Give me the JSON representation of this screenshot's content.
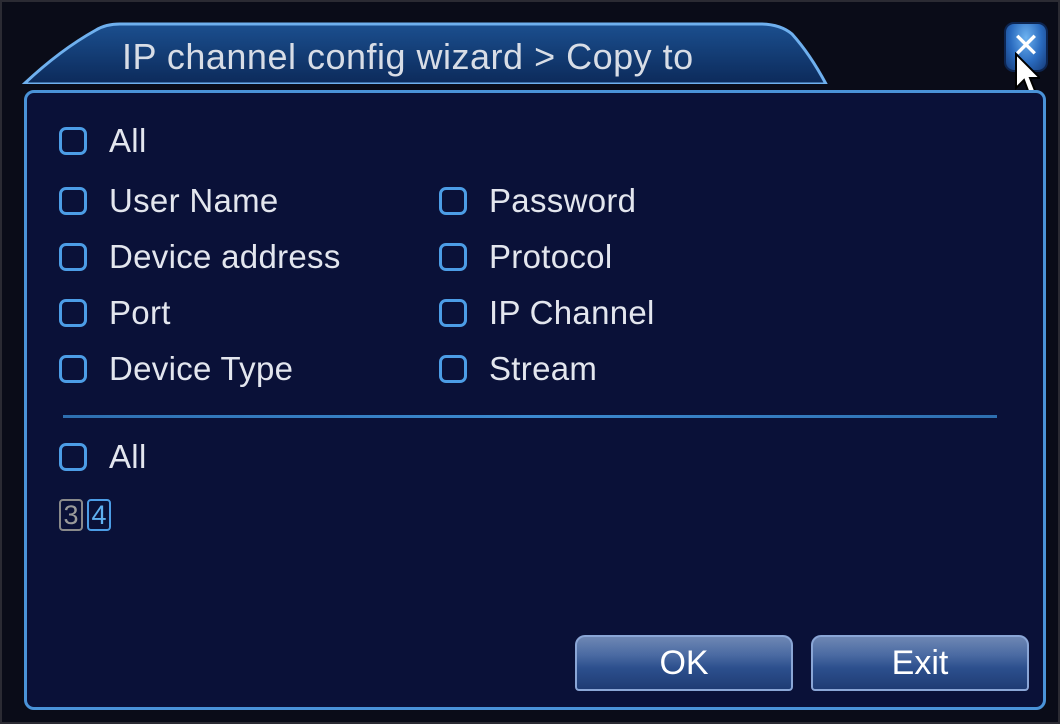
{
  "window": {
    "title": "IP channel config wizard > Copy to",
    "close_symbol": "✕"
  },
  "options_top": {
    "all_label": "All",
    "items": [
      {
        "label": "User Name"
      },
      {
        "label": "Password"
      },
      {
        "label": "Device address"
      },
      {
        "label": "Protocol"
      },
      {
        "label": "Port"
      },
      {
        "label": "IP Channel"
      },
      {
        "label": "Device Type"
      },
      {
        "label": "Stream"
      }
    ]
  },
  "channels": {
    "all_label": "All",
    "items": [
      {
        "number": "3"
      },
      {
        "number": "4"
      }
    ]
  },
  "buttons": {
    "ok_label": "OK",
    "exit_label": "Exit"
  },
  "colors": {
    "panel_bg": "#0a1138",
    "accent": "#4a93d8",
    "checkbox_border": "#4c9de6"
  }
}
